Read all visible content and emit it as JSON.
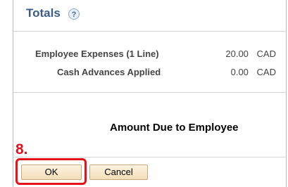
{
  "panel": {
    "title": "Totals",
    "help_glyph": "?",
    "help_icon": "help-question-icon"
  },
  "rows": [
    {
      "label": "Employee Expenses (1 Line)",
      "value": "20.00",
      "currency": "CAD"
    },
    {
      "label": "Cash Advances Applied",
      "value": "0.00",
      "currency": "CAD"
    }
  ],
  "amount_due_label": "Amount Due to Employee",
  "annotation": {
    "step_label": "8.",
    "color": "#e4121b"
  },
  "buttons": {
    "ok_label": "OK",
    "cancel_label": "Cancel"
  },
  "colors": {
    "title": "#3c5c87",
    "button_bg": "#f2ddb7",
    "button_border": "#c5aa80"
  }
}
